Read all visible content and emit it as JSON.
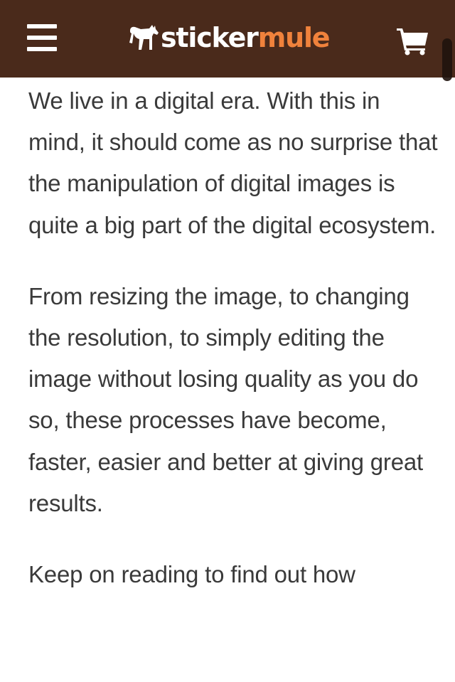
{
  "header": {
    "menu_icon": "hamburger-menu-icon",
    "logo": {
      "part1": "sticker",
      "part2": "mule",
      "mark_icon": "mule-logo-icon"
    },
    "cart_icon": "shopping-cart-icon",
    "colors": {
      "background": "#4a2a1b",
      "logo_accent": "#f0823c",
      "logo_white": "#ffffff"
    }
  },
  "article": {
    "paragraphs": [
      "We live in a digital era. With this in mind, it should come as no surprise that the manipulation of digital images is quite a big part of the digital ecosystem.",
      "From resizing the image, to changing the resolution, to simply editing the image without losing quality as you do so, these processes have become, faster, easier and better at giving great results.",
      "Keep on reading to find out how"
    ]
  }
}
